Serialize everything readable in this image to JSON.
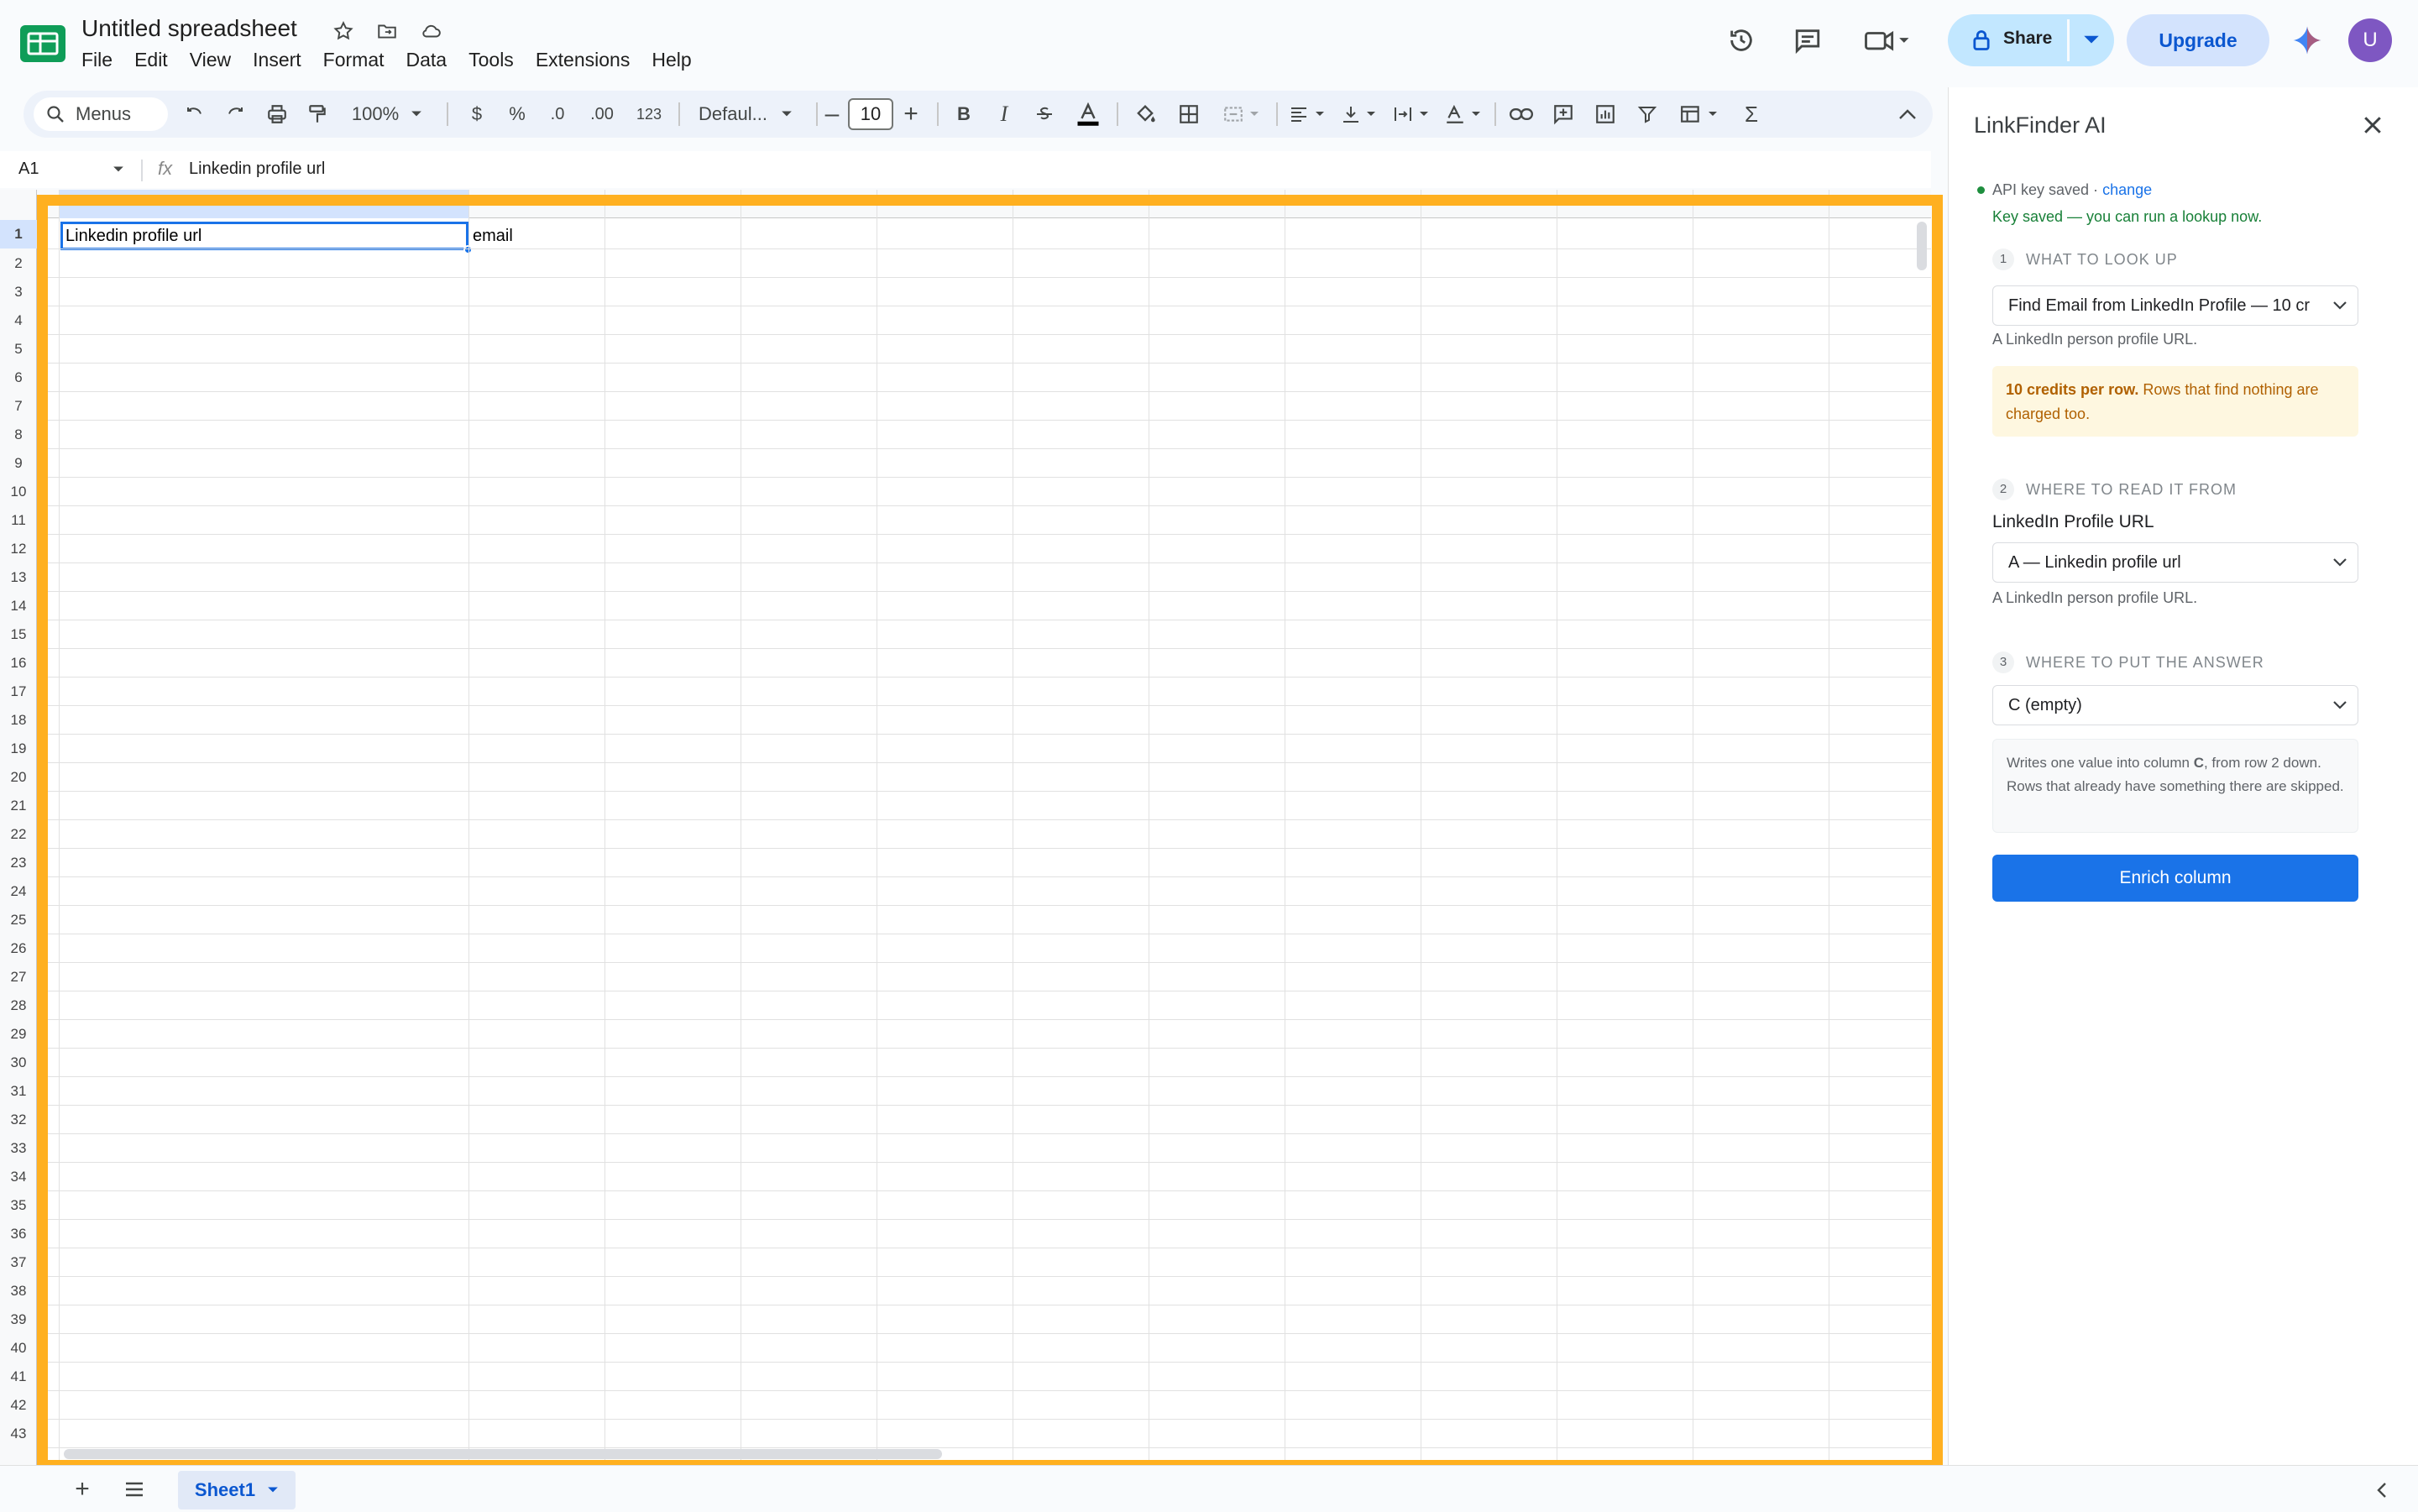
{
  "app": {
    "doc_title": "Untitled spreadsheet",
    "menus": [
      "File",
      "Edit",
      "View",
      "Insert",
      "Format",
      "Data",
      "Tools",
      "Extensions",
      "Help"
    ]
  },
  "header": {
    "share_label": "Share",
    "upgrade_label": "Upgrade",
    "avatar_letter": "U"
  },
  "toolbar": {
    "search_label": "Menus",
    "zoom": "100%",
    "currency": "$",
    "percent": "%",
    "dec_decrease": ".0",
    "dec_increase": ".00",
    "number_format": "123",
    "font": "Defaul...",
    "font_size": "10",
    "bold": "B",
    "italic": "I"
  },
  "formula_bar": {
    "cell_ref": "A1",
    "fx": "fx",
    "value": "Linkedin profile url"
  },
  "grid": {
    "rows": [
      "1",
      "2",
      "3",
      "4",
      "5",
      "6",
      "7",
      "8",
      "9",
      "10",
      "11",
      "12",
      "13",
      "14",
      "15",
      "16",
      "17",
      "18",
      "19",
      "20",
      "21",
      "22",
      "23",
      "24",
      "25",
      "26",
      "27",
      "28",
      "29",
      "30",
      "31",
      "32",
      "33",
      "34",
      "35",
      "36",
      "37",
      "38",
      "39",
      "40",
      "41",
      "42",
      "43"
    ],
    "cells": {
      "A1": "Linkedin profile url",
      "B1": "email"
    }
  },
  "sheets": {
    "active": "Sheet1"
  },
  "panel": {
    "title": "LinkFinder AI",
    "status": "API key saved ·",
    "status_link": "change",
    "status_ok": "Key saved — you can run a lookup now.",
    "step1": {
      "num": "1",
      "title": "WHAT TO LOOK UP",
      "selected": "Find Email from LinkedIn Profile — 10 cr",
      "hint": "A LinkedIn person profile URL."
    },
    "warning_bold": "10 credits per row.",
    "warning_text": "Rows that find nothing are charged too.",
    "step2": {
      "num": "2",
      "title": "WHERE TO READ IT FROM",
      "field_label": "LinkedIn Profile URL",
      "selected": "A — Linkedin profile url",
      "hint": "A LinkedIn person profile URL."
    },
    "step3": {
      "num": "3",
      "title": "WHERE TO PUT THE ANSWER",
      "selected": "C (empty)"
    },
    "info_pre": "Writes one value into column ",
    "info_col": "C",
    "info_post": ", from row 2 down. Rows that already have something there are skipped.",
    "button": "Enrich column"
  },
  "colors": {
    "accent": "#1a73e8",
    "highlight": "#ffb020",
    "share_bg": "#c2e7ff"
  }
}
